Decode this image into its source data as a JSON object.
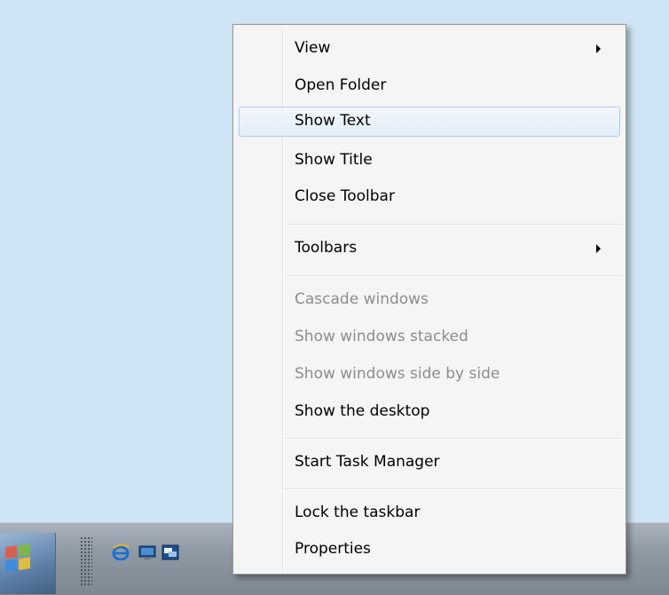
{
  "menu": {
    "items": [
      {
        "label": "View",
        "submenu": true,
        "enabled": true
      },
      {
        "label": "Open Folder",
        "submenu": false,
        "enabled": true
      },
      {
        "label": "Show Text",
        "submenu": false,
        "enabled": true,
        "highlighted": true
      },
      {
        "label": "Show Title",
        "submenu": false,
        "enabled": true
      },
      {
        "label": "Close Toolbar",
        "submenu": false,
        "enabled": true
      },
      {
        "label": "Toolbars",
        "submenu": true,
        "enabled": true
      },
      {
        "label": "Cascade windows",
        "submenu": false,
        "enabled": false
      },
      {
        "label": "Show windows stacked",
        "submenu": false,
        "enabled": false
      },
      {
        "label": "Show windows side by side",
        "submenu": false,
        "enabled": false
      },
      {
        "label": "Show the desktop",
        "submenu": false,
        "enabled": true
      },
      {
        "label": "Start Task Manager",
        "submenu": false,
        "enabled": true
      },
      {
        "label": "Lock the taskbar",
        "submenu": false,
        "enabled": true
      },
      {
        "label": "Properties",
        "submenu": false,
        "enabled": true
      }
    ]
  },
  "taskbar": {
    "quick_launch_icons": [
      "internet-explorer-icon",
      "show-desktop-icon",
      "switch-windows-icon"
    ]
  },
  "colors": {
    "desktop": "#cfe5f5",
    "menu_bg": "#f5f5f6",
    "highlight_border": "#aecbeb",
    "disabled_text": "#8d8d8d"
  }
}
